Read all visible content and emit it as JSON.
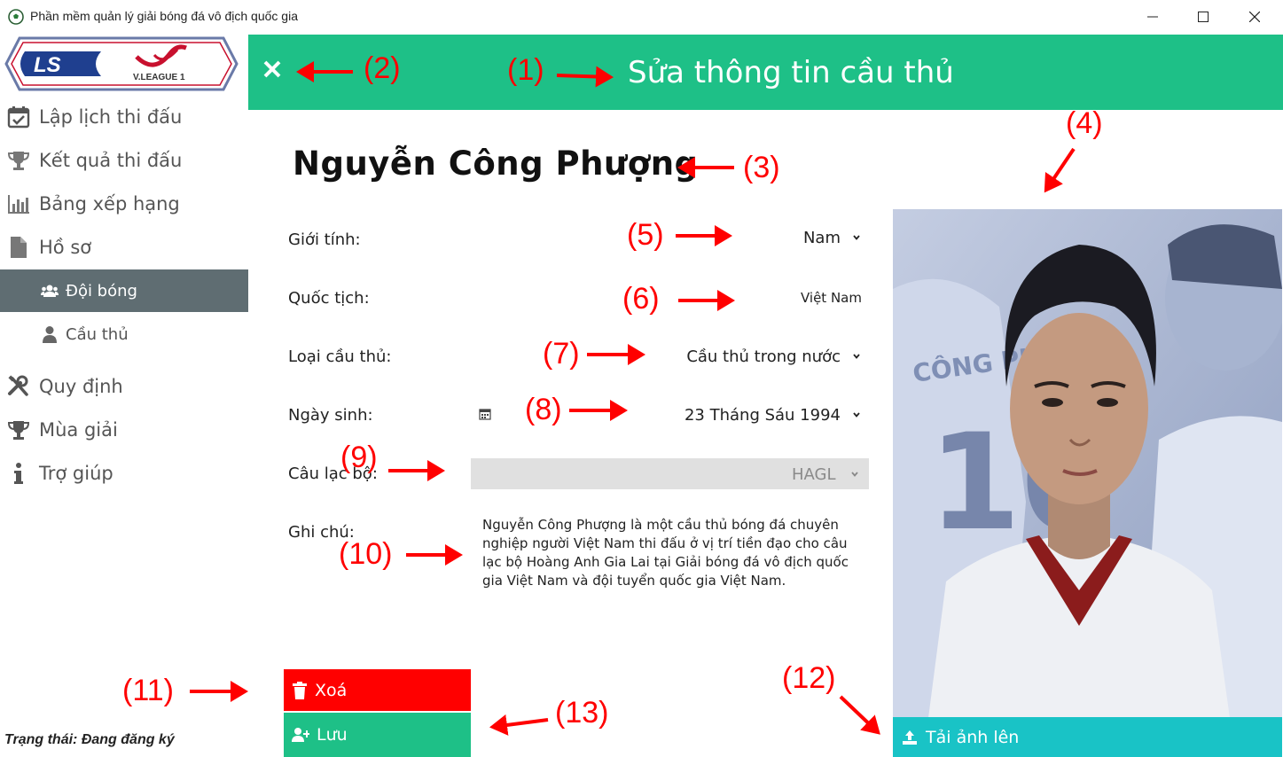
{
  "window": {
    "title": "Phần mềm quản lý giải bóng đá vô địch quốc gia"
  },
  "logo": {
    "brand_text": "LS",
    "league_text": "V.LEAGUE 1"
  },
  "sidebar": {
    "items": [
      {
        "label": "Lập lịch thi đấu",
        "icon": "calendar-check-icon"
      },
      {
        "label": "Kết quả thi đấu",
        "icon": "trophy-icon"
      },
      {
        "label": "Bảng xếp hạng",
        "icon": "bar-chart-icon"
      },
      {
        "label": "Hồ sơ",
        "icon": "file-icon"
      },
      {
        "label": "Đội bóng",
        "icon": "users-icon",
        "active": true
      },
      {
        "label": "Cầu thủ",
        "icon": "user-icon"
      },
      {
        "label": "Quy định",
        "icon": "tools-icon"
      },
      {
        "label": "Mùa giải",
        "icon": "trophy-icon"
      },
      {
        "label": "Trợ giúp",
        "icon": "info-icon"
      }
    ],
    "active_color": "#5f6d72"
  },
  "status": {
    "text": "Trạng thái: Đang đăng ký"
  },
  "header": {
    "title": "Sửa thông tin cầu thủ",
    "color": "#1ec087"
  },
  "player": {
    "name": "Nguyễn Công Phượng"
  },
  "form": {
    "gender": {
      "label": "Giới tính:",
      "value": "Nam"
    },
    "nationality": {
      "label": "Quốc tịch:",
      "value": "Việt Nam"
    },
    "player_type": {
      "label": "Loại cầu thủ:",
      "value": "Cầu thủ trong nước"
    },
    "birthdate": {
      "label": "Ngày sinh:",
      "value": "23 Tháng Sáu 1994"
    },
    "club": {
      "label": "Câu lạc bộ:",
      "value": "HAGL"
    },
    "note": {
      "label": "Ghi chú:",
      "value": "Nguyễn Công Phượng là một cầu thủ bóng đá chuyên nghiệp người Việt Nam thi đấu ở vị trí tiền đạo cho câu lạc bộ Hoàng Anh Gia Lai tại Giải bóng đá vô địch quốc gia Việt Nam và đội tuyển quốc gia Việt Nam."
    }
  },
  "photo": {
    "jersey_text": "CÔNG PHƯỢNG",
    "jersey_number": "10"
  },
  "buttons": {
    "delete": "Xoá",
    "save": "Lưu",
    "upload": "Tải ảnh lên",
    "delete_color": "#ff0000",
    "upload_color": "#19c3c6"
  },
  "annotations": [
    "(1)",
    "(2)",
    "(3)",
    "(4)",
    "(5)",
    "(6)",
    "(7)",
    "(8)",
    "(9)",
    "(10)",
    "(11)",
    "(12)",
    "(13)"
  ]
}
